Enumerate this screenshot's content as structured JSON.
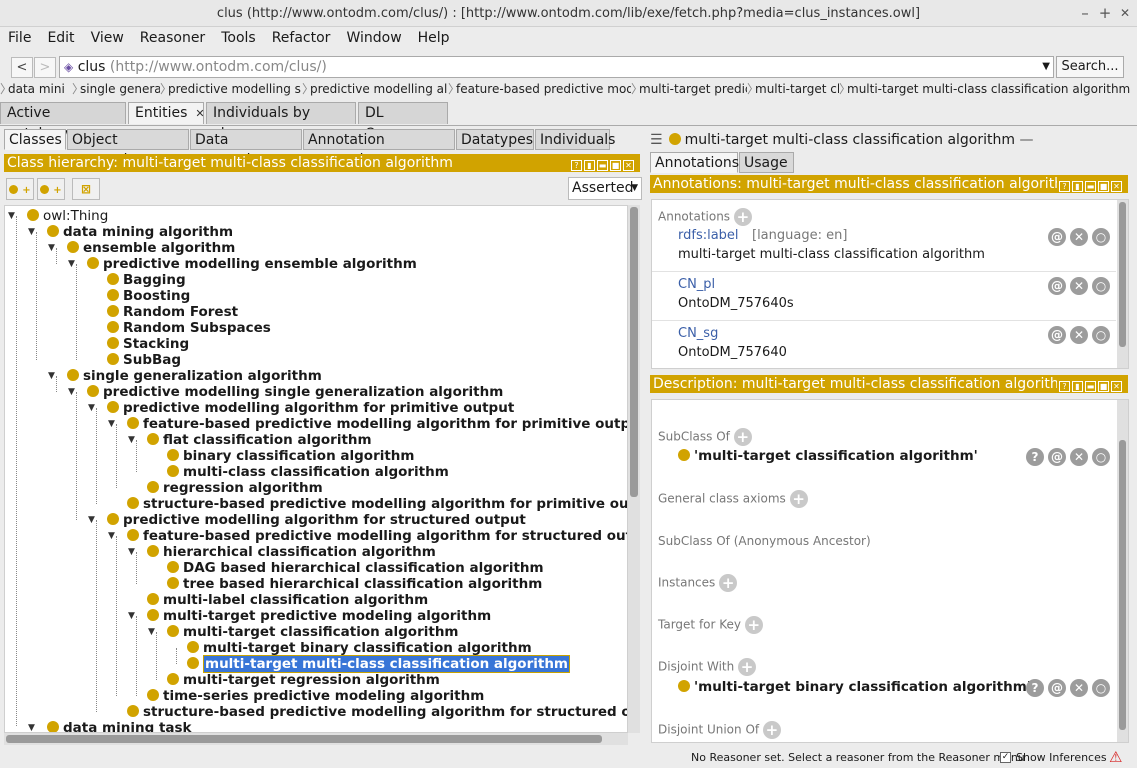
{
  "window": {
    "title": "clus (http://www.ontodm.com/clus/) : [http://www.ontodm.com/lib/exe/fetch.php?media=clus_instances.owl]",
    "minimize": "–",
    "maximize": "+",
    "close": "✕"
  },
  "menu": [
    "File",
    "Edit",
    "View",
    "Reasoner",
    "Tools",
    "Refactor",
    "Window",
    "Help"
  ],
  "nav": {
    "back": "<",
    "forward": ">",
    "ontology_name": "clus",
    "ontology_iri": "(http://www.ontodm.com/clus/)",
    "search_label": "Search..."
  },
  "breadcrumbs": [
    "data mini",
    "single genera",
    "predictive modelling si",
    "predictive modelling alc",
    "feature-based predictive mode",
    "multi-target predic",
    "multi-target cla",
    "multi-target multi-class classification algorithm"
  ],
  "main_tabs": [
    "Active ontology",
    "Entities",
    "Individuals by class",
    "DL Query"
  ],
  "sub_tabs": [
    "Classes",
    "Object properties",
    "Data properties",
    "Annotation properties",
    "Datatypes",
    "Individuals"
  ],
  "hierarchy": {
    "header": "Class hierarchy: multi-target multi-class classification algorithm",
    "mode": "Asserted",
    "nodes": [
      "owl:Thing",
      "data mining algorithm",
      "ensemble algorithm",
      "predictive modelling ensemble algorithm",
      "Bagging",
      "Boosting",
      "Random Forest",
      "Random Subspaces",
      "Stacking",
      "SubBag",
      "single generalization algorithm",
      "predictive modelling single generalization algorithm",
      "predictive modelling algorithm for primitive output",
      "feature-based predictive modelling algorithm for primitive output",
      "flat classification algorithm",
      "binary classification algorithm",
      "multi-class classification algorithm",
      "regression algorithm",
      "structure-based predictive modelling algorithm for primitive output",
      "predictive modelling algorithm for structured output",
      "feature-based predictive modelling algorithm for structured output",
      "hierarchical classification algorithm",
      "DAG based hierarchical classification algorithm",
      "tree based hierarchical classification algorithm",
      "multi-label classification algorithm",
      "multi-target predictive modeling algorithm",
      "multi-target classification algorithm",
      "multi-target binary classification algorithm",
      "multi-target multi-class classification algorithm",
      "multi-target regression algorithm",
      "time-series predictive modeling algorithm",
      "structure-based predictive modelling algorithm for structured outpu",
      "data mining task"
    ]
  },
  "right": {
    "entity": "multi-target multi-class classification algorithm",
    "entity_id": "OntoDM:757640",
    "tabs": [
      "Annotations",
      "Usage"
    ],
    "annotations_header": "Annotations: multi-target multi-class classification algorithm",
    "annotations_label": "Annotations",
    "annotations": [
      {
        "property": "rdfs:label",
        "lang": "[language: en]",
        "value": "multi-target multi-class classification algorithm"
      },
      {
        "property": "CN_pl",
        "lang": "",
        "value": "OntoDM_757640s"
      },
      {
        "property": "CN_sg",
        "lang": "",
        "value": "OntoDM_757640"
      }
    ],
    "description_header": "Description: multi-target multi-class classification algorithm",
    "sections": {
      "subclass_of": "SubClass Of",
      "subclass_value": "'multi-target classification algorithm'",
      "general_axioms": "General class axioms",
      "anon_ancestor": "SubClass Of (Anonymous Ancestor)",
      "instances": "Instances",
      "target_key": "Target for Key",
      "disjoint_with": "Disjoint With",
      "disjoint_value": "'multi-target binary classification algorithm'",
      "disjoint_union": "Disjoint Union Of"
    }
  },
  "status": {
    "reasoner": "No Reasoner set. Select a reasoner from the Reasoner menu",
    "show_inferences": "Show Inferences"
  }
}
